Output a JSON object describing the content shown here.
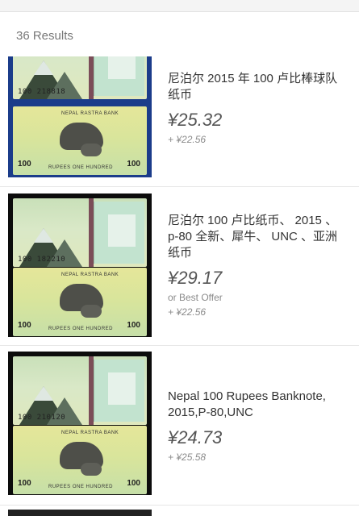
{
  "header": {
    "results": "36 Results"
  },
  "listings": [
    {
      "title": "尼泊尔 2015 年 100 卢比棒球队纸币",
      "price": "¥25.32",
      "shipping": "+ ¥22.56",
      "best_offer": "",
      "serial_front": "100 218818",
      "note_text": {
        "back_header": "NEPAL RASTRA BANK",
        "back_footer": "RUPEES ONE HUNDRED",
        "denom": "100"
      }
    },
    {
      "title": "尼泊尔 100 卢比纸币、 2015 、p-80 全新、犀牛、 UNC 、亚洲纸币",
      "price": "¥29.17",
      "shipping": "+ ¥22.56",
      "best_offer": "or Best Offer",
      "serial_front": "100 182210",
      "note_text": {
        "back_header": "NEPAL RASTRA BANK",
        "back_footer": "RUPEES ONE HUNDRED",
        "denom": "100"
      }
    },
    {
      "title": "Nepal 100 Rupees Banknote, 2015,P-80,UNC",
      "price": "¥24.73",
      "shipping": "+ ¥25.58",
      "best_offer": "",
      "serial_front": "100 210120",
      "note_text": {
        "back_header": "NEPAL RASTRA BANK",
        "back_footer": "RUPEES ONE HUNDRED",
        "denom": "100"
      }
    }
  ],
  "colors": {
    "divider": "#e7e7e7",
    "price": "#555555",
    "muted": "#8b8b8b",
    "thumb_bg": "#0c0c0c"
  },
  "icons": {
    "banknote_image": "nepal-100-rupee-banknote-image"
  }
}
